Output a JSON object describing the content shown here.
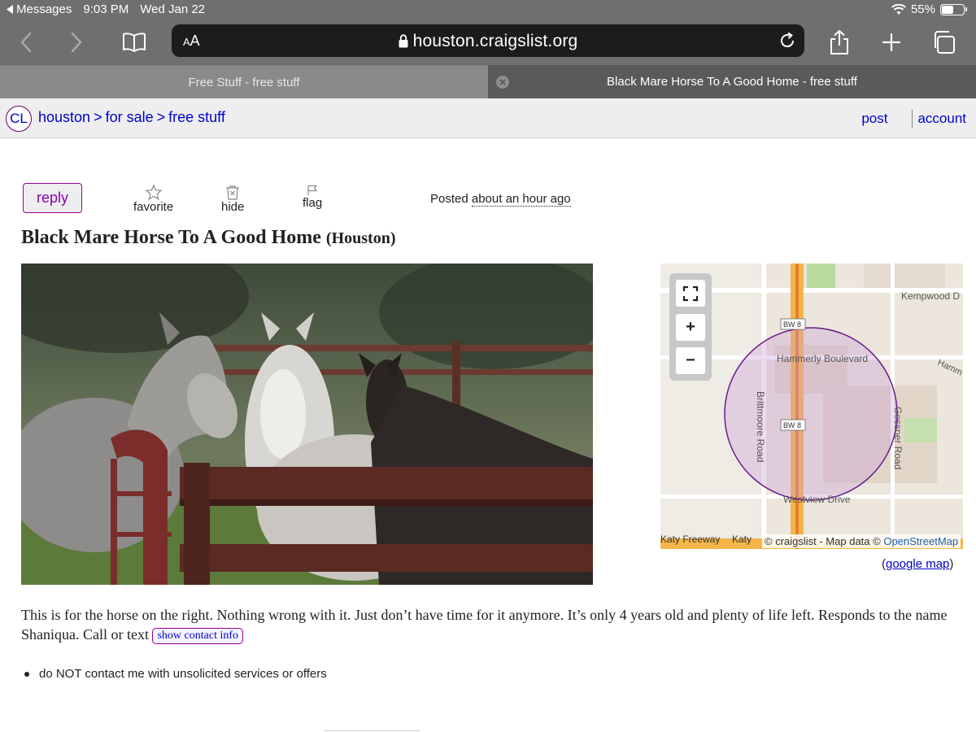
{
  "status_bar": {
    "back_app": "Messages",
    "time": "9:03 PM",
    "date": "Wed Jan 22",
    "battery": "55%",
    "battery_level": 0.55
  },
  "address_bar": {
    "aa_label": "A",
    "aa_label_large": "A",
    "url": "houston.craigslist.org"
  },
  "tabs": [
    {
      "label": "Free Stuff - free stuff",
      "active": false
    },
    {
      "label": "Black Mare Horse To A Good Home - free stuff",
      "active": true
    }
  ],
  "header": {
    "logo": "CL",
    "breadcrumbs": [
      "houston",
      "for sale",
      "free stuff"
    ],
    "breadcrumb_sep": ">",
    "post_link": "post",
    "account_link": "account"
  },
  "actions": {
    "reply": "reply",
    "favorite": "favorite",
    "hide": "hide",
    "flag": "flag",
    "posted_label": "Posted",
    "posted_ago": "about an hour ago"
  },
  "posting": {
    "title": "Black Mare Horse To A Good Home",
    "location": "(Houston)",
    "body": "This is for the horse on the right. Nothing wrong with it. Just don’t have time for it anymore. It’s only 4 years old and plenty of life left. Responds to the name Shaniqua. Call or text",
    "show_contact": "show contact info",
    "notice": "do NOT contact me with unsolicited services or offers"
  },
  "map": {
    "labels": {
      "kempwood": "Kempwood D",
      "hammerly": "Hammerly Boulevard",
      "hamm": "Hamm",
      "brittmoore": "Brittmoore Road",
      "gessner": "Gessner Road",
      "westview": "Westview Drive",
      "katy_freeway": "Katy Freeway",
      "katy": "Katy",
      "bw8_top": "BW 8",
      "bw8_mid": "BW 8"
    },
    "credit_prefix": "© craigslist - Map data ©",
    "credit_osm": "OpenStreetMap",
    "google_prefix": "(",
    "google_link": "google map",
    "google_suffix": ")",
    "zoom_in": "+",
    "zoom_out": "−"
  }
}
